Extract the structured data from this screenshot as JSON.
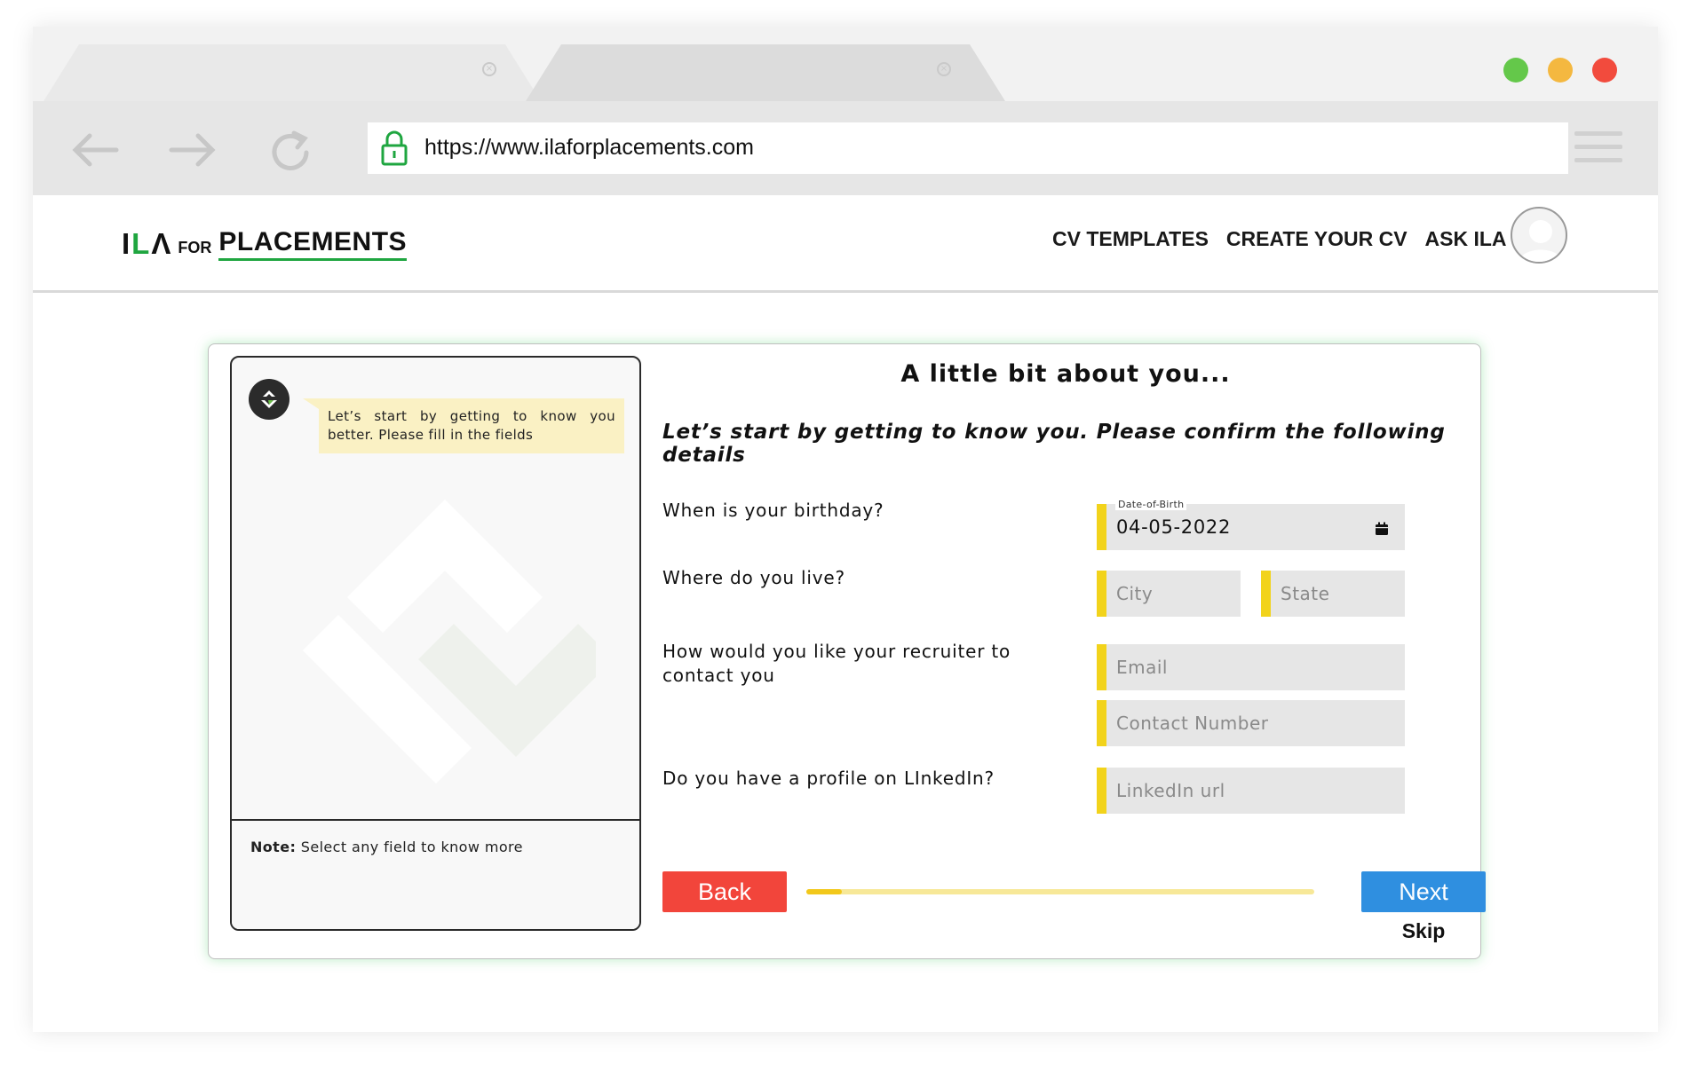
{
  "browser": {
    "url": "https://www.ilaforplacements.com",
    "tab_close_glyph": "×",
    "window_controls": {
      "green": "#64c84a",
      "yellow": "#f4b840",
      "red": "#f24b3d"
    }
  },
  "header": {
    "logo": {
      "ila_prefix": "IL",
      "ila_suffix": "Λ",
      "for_text": "FOR",
      "placements_text": "PLACEMENTS"
    },
    "nav": [
      {
        "label": "CV TEMPLATES"
      },
      {
        "label": "CREATE YOUR CV"
      },
      {
        "label": "ASK ILA"
      }
    ]
  },
  "assistant": {
    "message": "Let’s start by getting to know you better. Please fill in the fields",
    "note_label": "Note:",
    "note_text": " Select any field to know more"
  },
  "form": {
    "title": "A little bit about you...",
    "subtitle": "Let’s start by getting to know you. Please confirm the following details",
    "questions": {
      "birthday": "When is your birthday?",
      "location": "Where do you live?",
      "contact": "How would you like your recruiter to contact you",
      "linkedin": "Do you have a profile on LInkedIn?"
    },
    "fields": {
      "dob_label": "Date-of-Birth",
      "dob_value": "04-05-2022",
      "city_placeholder": "City",
      "state_placeholder": "State",
      "email_placeholder": "Email",
      "contact_placeholder": "Contact Number",
      "linkedin_placeholder": "LinkedIn url"
    },
    "buttons": {
      "back": "Back",
      "next": "Next",
      "skip": "Skip"
    },
    "progress_percent": 7
  },
  "colors": {
    "accent_green": "#1fa640",
    "field_marker": "#f2d31b",
    "back_button": "#f2453b",
    "next_button": "#2f8fe0"
  }
}
